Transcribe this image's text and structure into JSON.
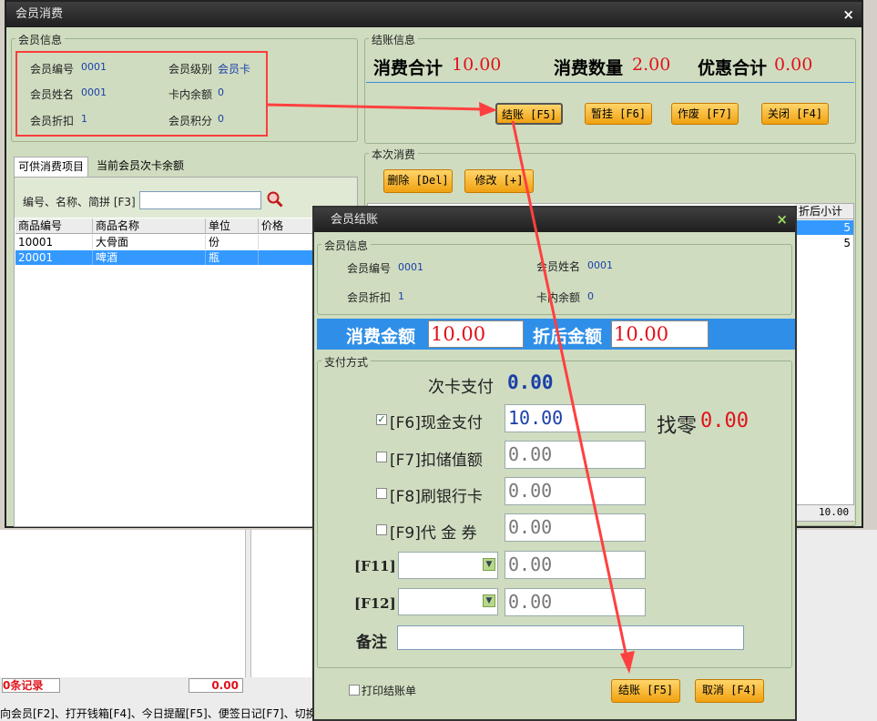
{
  "main_window": {
    "title": "会员消费",
    "close_glyph": "×",
    "member_info": {
      "group_label": "会员信息",
      "member_no_label": "会员编号",
      "member_no": "0001",
      "member_level_label": "会员级别",
      "member_level": "会员卡",
      "member_name_label": "会员姓名",
      "member_name": "0001",
      "card_balance_label": "卡内余额",
      "card_balance": "0",
      "discount_label": "会员折扣",
      "discount": "1",
      "points_label": "会员积分",
      "points": "0"
    },
    "checkout_info": {
      "group_label": "结账信息",
      "total_label": "消费合计",
      "total": "10.00",
      "qty_label": "消费数量",
      "qty": "2.00",
      "discount_label": "优惠合计",
      "discount": "0.00",
      "buttons": [
        "结账 [F5]",
        "暂挂 [F6]",
        "作废 [F7]",
        "关闭 [F4]"
      ]
    },
    "tabs": [
      "可供消费项目",
      "当前会员次卡余额"
    ],
    "search_label": "编号、名称、简拼 [F3]",
    "search_value": "",
    "product_table": {
      "headers": [
        "商品编号",
        "商品名称",
        "单位",
        "价格"
      ],
      "rows": [
        [
          "10001",
          "大骨面",
          "份",
          ""
        ],
        [
          "20001",
          "啤酒",
          "瓶",
          ""
        ]
      ]
    },
    "current_consumption": {
      "group_label": "本次消费",
      "delete_button": "删除 [Del]",
      "modify_button": "修改 [+]",
      "header_last": "折后小计",
      "row_values": [
        "5",
        "5"
      ],
      "footer_total": "10.00"
    }
  },
  "background": {
    "records_label": "0条记录",
    "records_amount": "0.00",
    "status_bar": "向会员[F2]、打开钱箱[F4]、今日提醒[F5]、便签日记[F7]、切换"
  },
  "checkout_dialog": {
    "title": "会员结账",
    "close_glyph": "×",
    "member_group_label": "会员信息",
    "member_no_label": "会员编号",
    "member_no": "0001",
    "member_name_label": "会员姓名",
    "member_name": "0001",
    "discount_label": "会员折扣",
    "discount": "1",
    "balance_label": "卡内余额",
    "balance": "0",
    "amount_label": "消费金额",
    "amount": "10.00",
    "after_discount_label": "折后金额",
    "after_discount": "10.00",
    "payment_group_label": "支付方式",
    "times_card_label": "次卡支付",
    "times_card_value": "0.00",
    "cash_label": "[F6]现金支付",
    "cash_value": "10.00",
    "cash_checked": true,
    "change_label": "找零",
    "change_value": "0.00",
    "stored_label": "[F7]扣储值额",
    "stored_value": "0.00",
    "bank_label": "[F8]刷银行卡",
    "bank_value": "0.00",
    "voucher_label": "[F9]代 金 券",
    "voucher_value": "0.00",
    "f11_label": "[F11]",
    "f11_value": "0.00",
    "f12_label": "[F12]",
    "f12_value": "0.00",
    "note_label": "备注",
    "note_value": "",
    "print_label": "打印结账单",
    "confirm_button": "结账 [F5]",
    "cancel_button": "取消 [F4]"
  },
  "colors": {
    "accent_red": "#e0121a",
    "annotation_red": "#ff4040",
    "button_orange": "#f0a110",
    "panel_green": "#cfdcc0",
    "dialog_blue": "#2f8fe8"
  }
}
